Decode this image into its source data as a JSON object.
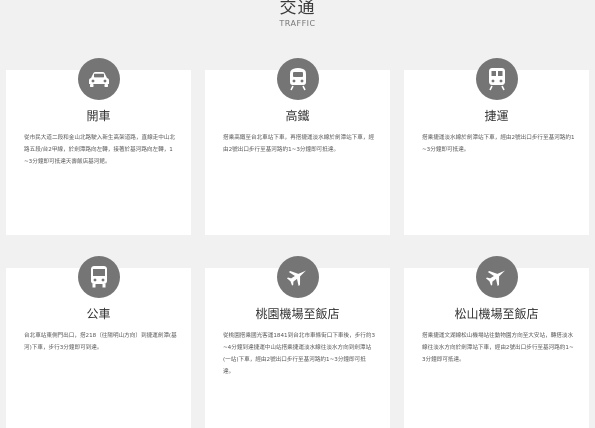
{
  "header": {
    "title": "交通",
    "subtitle": "TRAFFIC"
  },
  "cards": [
    {
      "title": "開車",
      "icon": "car-icon",
      "description": "從市民大道二段和金山北路駛入新生高架道路，直線走中山北路五段/台2甲線，於劍潭路向左轉，接著於基河路向左轉，1~3分鐘即可抵達天壽飯店基河館。"
    },
    {
      "title": "高鐵",
      "icon": "train-icon",
      "description": "搭乘高鐵至台北車站下車，再搭捷運淡水線於劍潭站下車，經由2號出口步行至基河路約1~3分鐘即可抵達。"
    },
    {
      "title": "捷運",
      "icon": "metro-icon",
      "description": "搭乘捷運淡水線於劍潭站下車，經由2號出口步行至基河路約1~3分鐘即可抵達。"
    },
    {
      "title": "公車",
      "icon": "bus-icon",
      "description": "台北車站東側門出口，搭218（往陽明山方向）到捷運劍潭(基河)下車，步行3分鐘即可到達。"
    },
    {
      "title": "桃園機場至飯店",
      "icon": "airplane-icon",
      "description": "從桃園搭乘國光客運1841到台北市車條街口下車後，步行約3~4分鐘到達捷運中山站搭乘捷運淡水線往淡水方向到劍潭站(一站)下車，經由2號出口步行至基河路約1~3分鐘即可抵達。"
    },
    {
      "title": "松山機場至飯店",
      "icon": "airplane-icon",
      "description": "搭乘捷運文湖線松山機場站往動物園方向至大安站，轉搭淡水線往淡水方向於劍潭站下車，經由2號出口步行至基河路約1~3分鐘即可抵達。"
    }
  ],
  "colors": {
    "icon_bg": "#757575",
    "card_bg": "#ffffff",
    "page_bg": "#f1f1f1"
  }
}
